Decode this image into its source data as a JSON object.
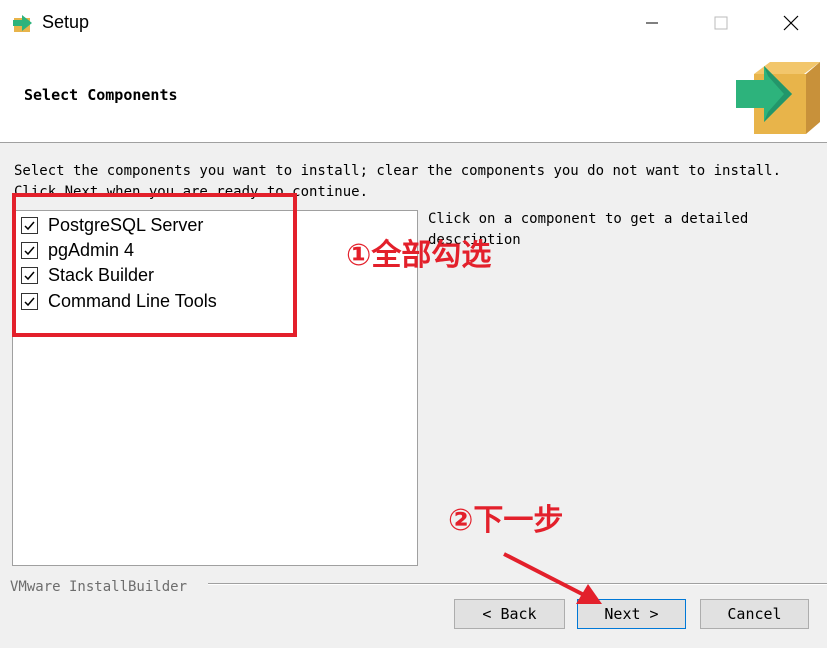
{
  "window": {
    "title": "Setup"
  },
  "header": {
    "title": "Select Components"
  },
  "instructions": "Select the components you want to install; clear the components you do not want to install. Click Next when you are ready to continue.",
  "components": [
    {
      "label": "PostgreSQL Server",
      "checked": true
    },
    {
      "label": "pgAdmin 4",
      "checked": true
    },
    {
      "label": "Stack Builder",
      "checked": true
    },
    {
      "label": "Command Line Tools",
      "checked": true
    }
  ],
  "description": "Click on a component to get a detailed description",
  "footer": {
    "brand": "VMware InstallBuilder",
    "back_label": "< Back",
    "next_label": "Next >",
    "cancel_label": "Cancel"
  },
  "annotations": {
    "step1": "①全部勾选",
    "step2": "②下一步"
  },
  "colors": {
    "annotation_red": "#e3202b",
    "accent_green": "#2db37c",
    "box_orange": "#e8b44a"
  }
}
